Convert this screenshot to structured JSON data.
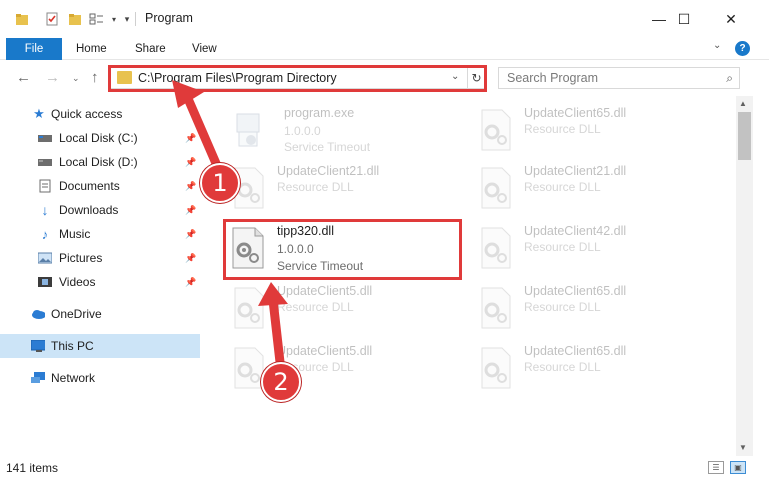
{
  "window": {
    "title": "Program",
    "minimize_glyph": "—",
    "maximize_glyph": "☐",
    "close_glyph": "✕"
  },
  "ribbon": {
    "tabs": [
      "File",
      "Home",
      "Share",
      "View"
    ],
    "help_glyph": "?",
    "accent_color": "#1979ca"
  },
  "navigation": {
    "address_path": "C:\\Program Files\\Program Directory",
    "search_placeholder": "Search Program"
  },
  "sidebar": {
    "items": [
      {
        "label": "Quick access",
        "icon": "star-icon",
        "pinned": false
      },
      {
        "label": "Local Disk (C:)",
        "icon": "drive-icon",
        "pinned": true
      },
      {
        "label": "Local Disk (D:)",
        "icon": "drive-icon",
        "pinned": true
      },
      {
        "label": "Documents",
        "icon": "documents-icon",
        "pinned": true
      },
      {
        "label": "Downloads",
        "icon": "download-icon",
        "pinned": true
      },
      {
        "label": "Music",
        "icon": "music-icon",
        "pinned": true
      },
      {
        "label": "Pictures",
        "icon": "pictures-icon",
        "pinned": true
      },
      {
        "label": "Videos",
        "icon": "videos-icon",
        "pinned": true
      },
      {
        "label": "OneDrive",
        "icon": "cloud-icon",
        "pinned": false
      },
      {
        "label": "This PC",
        "icon": "computer-icon",
        "pinned": false,
        "selected": true
      },
      {
        "label": "Network",
        "icon": "network-icon",
        "pinned": false
      }
    ]
  },
  "files": [
    {
      "name": "program.exe",
      "line1": "1.0.0.0",
      "line2": "Service Timeout",
      "kind": "exe"
    },
    {
      "name": "UpdateClient65.dll",
      "line1": "Resource DLL",
      "line2": "",
      "kind": "dll"
    },
    {
      "name": "UpdateClient21.dll",
      "line1": "Resource DLL",
      "line2": "",
      "kind": "dll"
    },
    {
      "name": "UpdateClient21.dll",
      "line1": "Resource DLL",
      "line2": "",
      "kind": "dll"
    },
    {
      "name": "tipp320.dll",
      "line1": "1.0.0.0",
      "line2": "Service Timeout",
      "kind": "dll",
      "highlighted": true
    },
    {
      "name": "UpdateClient42.dll",
      "line1": "Resource DLL",
      "line2": "",
      "kind": "dll"
    },
    {
      "name": "UpdateClient5.dll",
      "line1": "Resource DLL",
      "line2": "",
      "kind": "dll"
    },
    {
      "name": "UpdateClient65.dll",
      "line1": "Resource DLL",
      "line2": "",
      "kind": "dll"
    },
    {
      "name": "UpdateClient5.dll",
      "line1": "Resource DLL",
      "line2": "",
      "kind": "dll"
    },
    {
      "name": "UpdateClient65.dll",
      "line1": "Resource DLL",
      "line2": "",
      "kind": "dll"
    }
  ],
  "status": {
    "item_count": "141 items"
  },
  "annotations": {
    "step1": "1",
    "step2": "2",
    "highlight_color": "#e03a3a"
  }
}
